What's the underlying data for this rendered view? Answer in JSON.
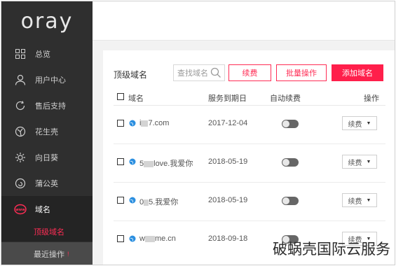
{
  "brand": {
    "logo": "oray"
  },
  "sidebar": {
    "items": [
      {
        "label": "总览",
        "icon": "grid-icon"
      },
      {
        "label": "用户中心",
        "icon": "user-icon"
      },
      {
        "label": "售后支持",
        "icon": "refresh-icon"
      },
      {
        "label": "花生壳",
        "icon": "globe-icon"
      },
      {
        "label": "向日葵",
        "icon": "sunflower-icon"
      },
      {
        "label": "蒲公英",
        "icon": "swirl-icon"
      },
      {
        "label": "域名",
        "icon": "www-icon"
      }
    ],
    "subitems": [
      {
        "label": "顶级域名"
      },
      {
        "label": "最近操作"
      }
    ],
    "active_color": "#ff2d55"
  },
  "main": {
    "title": "顶级域名",
    "search_placeholder": "查找域名",
    "buttons": {
      "renew": "续费",
      "batch": "批量操作",
      "add": "添加域名"
    },
    "columns": {
      "domain": "域名",
      "expiry": "服务到期日",
      "auto_renew": "自动续费",
      "action": "操作"
    },
    "rows": [
      {
        "prefix": "i",
        "suffix": "7.com",
        "expiry": "2017-12-04",
        "action": "续费"
      },
      {
        "prefix": "5",
        "suffix": "love.我爱你",
        "expiry": "2018-05-19",
        "action": "续费"
      },
      {
        "prefix": "0",
        "suffix": "5.我爱你",
        "expiry": "2018-05-19",
        "action": "续费"
      },
      {
        "prefix": "w",
        "suffix": "me.cn",
        "expiry": "2018-09-18",
        "action": "续费"
      }
    ]
  },
  "watermark": "破蜗壳国际云服务"
}
